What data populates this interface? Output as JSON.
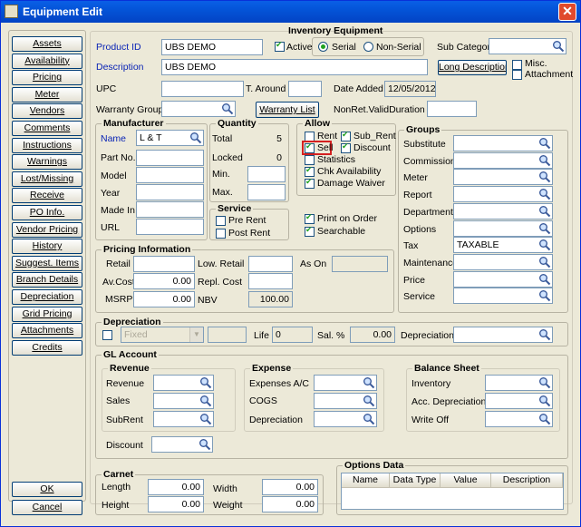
{
  "window": {
    "title": "Equipment Edit",
    "close": "✕"
  },
  "sidebar": [
    "Assets",
    "Availability",
    "Pricing",
    "Meter",
    "Vendors",
    "Comments",
    "Instructions",
    "Warnings",
    "Lost/Missing",
    "Receive",
    "PO Info.",
    "Vendor Pricing",
    "History",
    "Suggest. Items",
    "Branch Details",
    "Depreciation",
    "Grid Pricing",
    "Attachments",
    "Credits"
  ],
  "footer": {
    "ok": "OK",
    "cancel": "Cancel"
  },
  "inventory": {
    "title": "Inventory Equipment",
    "product_id_label": "Product ID",
    "product_id": "UBS DEMO",
    "active_label": "Active",
    "serial_label": "Serial",
    "nonserial_label": "Non-Serial",
    "subcat_label": "Sub Category",
    "subcat": "",
    "description_label": "Description",
    "description": "UBS DEMO",
    "long_desc_btn": "Long Description",
    "misc_label": "Misc.",
    "attachment_label": "Attachment",
    "upc_label": "UPC",
    "upc": "",
    "taround_label": "T. Around",
    "taround": "",
    "date_added_label": "Date Added",
    "date_added": "12/05/2012",
    "warranty_group_label": "Warranty Group",
    "warranty_group": "",
    "warranty_list_btn": "Warranty List",
    "nonret_label": "NonRet.ValidDuration",
    "nonret": ""
  },
  "manufacturer": {
    "title": "Manufacturer",
    "name_label": "Name",
    "name": "L & T",
    "partno_label": "Part No.",
    "model_label": "Model",
    "year_label": "Year",
    "madein_label": "Made In",
    "url_label": "URL"
  },
  "quantity": {
    "title": "Quantity",
    "total_label": "Total",
    "total": "5",
    "locked_label": "Locked",
    "locked": "0",
    "min_label": "Min.",
    "max_label": "Max."
  },
  "allow": {
    "title": "Allow",
    "rent": "Rent",
    "sub_rent": "Sub_Rent",
    "sell": "Sell",
    "discount": "Discount",
    "statistics": "Statistics",
    "chk_avail": "Chk Availability",
    "damage": "Damage Waiver"
  },
  "service": {
    "title": "Service",
    "pre_rent": "Pre Rent",
    "post_rent": "Post Rent"
  },
  "misc_checks": {
    "print_on_order": "Print on Order",
    "searchable": "Searchable"
  },
  "groups": {
    "title": "Groups",
    "items": [
      {
        "label": "Substitute",
        "value": ""
      },
      {
        "label": "Commission",
        "value": ""
      },
      {
        "label": "Meter",
        "value": ""
      },
      {
        "label": "Report",
        "value": ""
      },
      {
        "label": "Department",
        "value": ""
      },
      {
        "label": "Options",
        "value": ""
      },
      {
        "label": "Tax",
        "value": "TAXABLE"
      },
      {
        "label": "Maintenance",
        "value": ""
      },
      {
        "label": "Price",
        "value": ""
      },
      {
        "label": "Service",
        "value": ""
      }
    ]
  },
  "pricing": {
    "title": "Pricing Information",
    "retail_label": "Retail",
    "retail": "",
    "low_retail_label": "Low. Retail",
    "low_retail": "",
    "as_on_label": "As On",
    "as_on": "",
    "avcost_label": "Av.Cost",
    "avcost": "0.00",
    "repl_label": "Repl. Cost",
    "repl": "",
    "msrp_label": "MSRP",
    "msrp": "0.00",
    "nbv_label": "NBV",
    "nbv": "100.00"
  },
  "depreciation": {
    "title": "Depreciation",
    "method": "Fixed",
    "life_label": "Life",
    "life": "0",
    "sal_label": "Sal. %",
    "sal": "0.00",
    "dep_label": "Depreciation",
    "dep": ""
  },
  "gl": {
    "title": "GL Account",
    "revenue_title": "Revenue",
    "revenue_label": "Revenue",
    "sales_label": "Sales",
    "subrent_label": "SubRent",
    "expense_title": "Expense",
    "expenses_ac_label": "Expenses A/C",
    "cogs_label": "COGS",
    "depreciation_label": "Depreciation",
    "balance_title": "Balance Sheet",
    "inventory_label": "Inventory",
    "acc_dep_label": "Acc. Depreciation",
    "writeoff_label": "Write Off",
    "discount_label": "Discount"
  },
  "carnet": {
    "title": "Carnet",
    "length_label": "Length",
    "length": "0.00",
    "width_label": "Width",
    "width": "0.00",
    "height_label": "Height",
    "height": "0.00",
    "weight_label": "Weight",
    "weight": "0.00"
  },
  "options_data": {
    "title": "Options Data",
    "columns": [
      "Name",
      "Data Type",
      "Value",
      "Description"
    ]
  }
}
